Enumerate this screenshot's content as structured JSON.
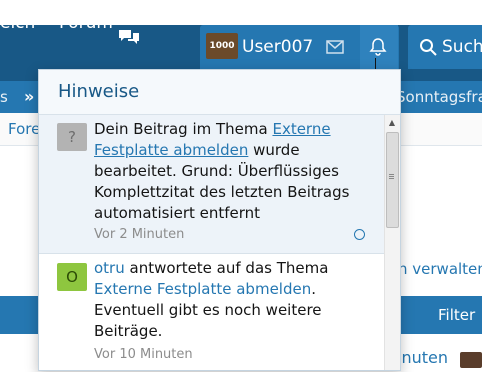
{
  "nav": {
    "areas_fragment": "eich",
    "forum": "Forum",
    "user": "User007",
    "avatar_text": "1000",
    "search": "Such"
  },
  "subnav": {
    "left": "s",
    "arrow": "»",
    "right": "Sonntagsfrag"
  },
  "breadcrumb": "Fore",
  "page": {
    "manage": "n verwalten ▾",
    "filter": "Filter ▾",
    "bottom": "inuten"
  },
  "popup": {
    "title": "Hinweise",
    "alerts": [
      {
        "avatar_letter": "?",
        "text_before": "Dein Beitrag im Thema ",
        "link": "Externe Festplatte abmelden",
        "text_after": " wurde bearbeitet. Grund: Überflüssiges Komplettzitat des letzten Beitrags automatisiert entfernt",
        "time": "Vor 2 Minuten"
      },
      {
        "avatar_letter": "O",
        "user": "otru",
        "text_before": " antwortete auf das Thema ",
        "link": "Externe Festplatte abmelden",
        "text_after": ". Eventuell gibt es noch weitere Beiträge.",
        "time": "Vor 10 Minuten"
      }
    ]
  },
  "colors": {
    "navbar": "#185886",
    "accent": "#2577b1",
    "unread_bg": "#edf3f9"
  }
}
